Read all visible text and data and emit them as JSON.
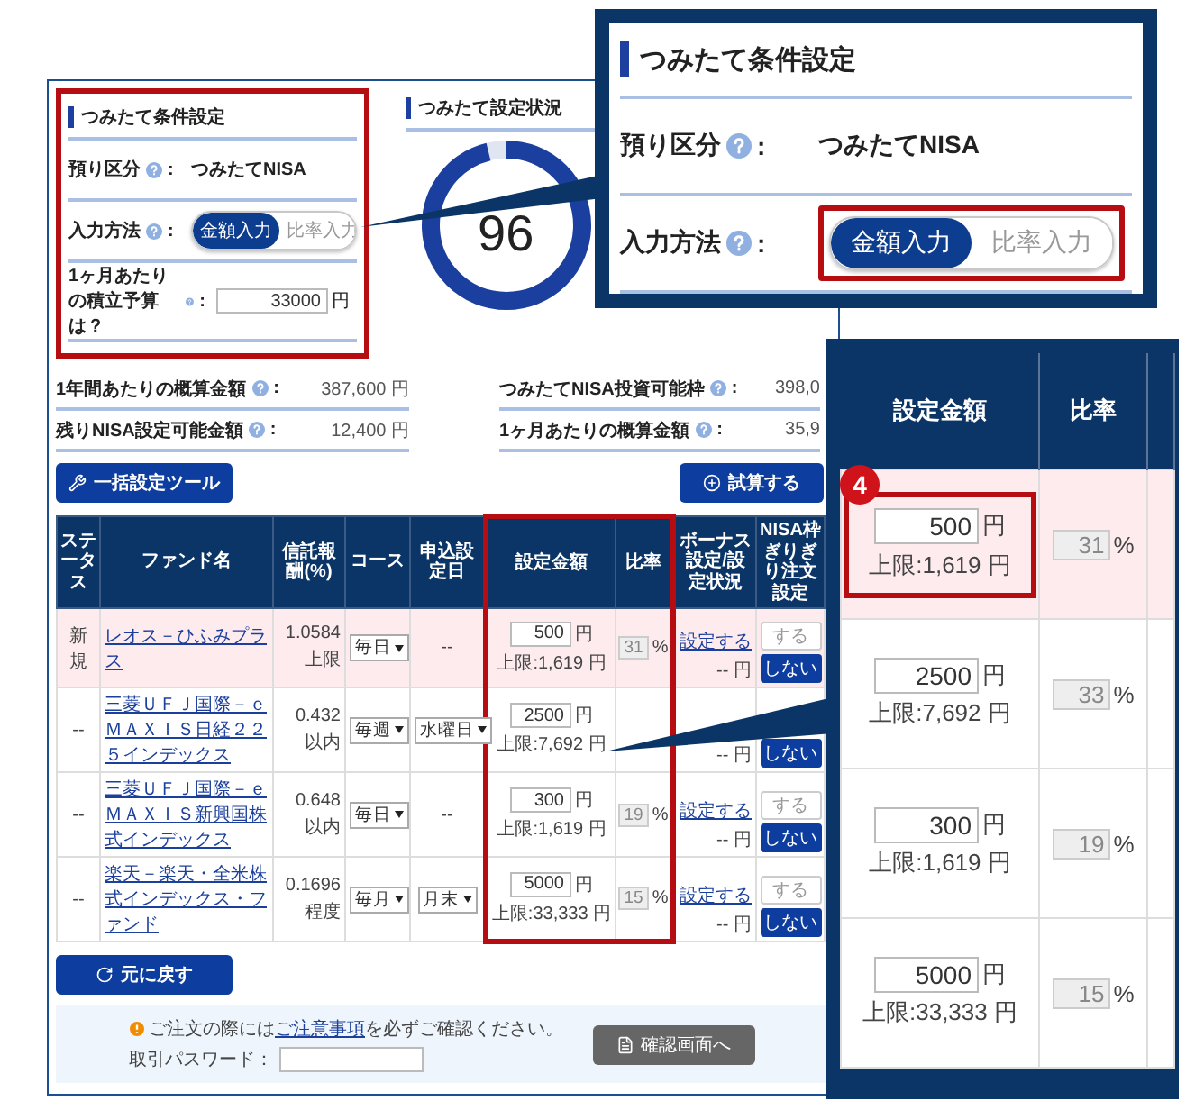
{
  "condition_settings": {
    "title": "つみたて条件設定",
    "rows": [
      {
        "kind": "text",
        "label": "預り区分",
        "colon": ":",
        "value": "つみたてNISA"
      },
      {
        "kind": "toggle",
        "label": "入力方法",
        "colon": ":",
        "options": [
          {
            "label": "金額入力",
            "selected": true
          },
          {
            "label": "比率入力",
            "selected": false
          }
        ]
      },
      {
        "kind": "input",
        "label": "1ヶ月あたりの積立予算は？",
        "colon": ":",
        "value": "33000",
        "unit": "円"
      }
    ]
  },
  "status": {
    "title": "つみたて設定状況",
    "percent": "96",
    "level": 0.96
  },
  "summary": [
    [
      {
        "label": "1年間あたりの概算金額",
        "colon": ":",
        "value": "387,600 円"
      },
      {
        "label": "残りNISA設定可能金額",
        "colon": ":",
        "value": "12,400 円"
      }
    ],
    [
      {
        "label": "つみたてNISA投資可能枠",
        "colon": ":",
        "value": "398,0"
      },
      {
        "label": "1ヶ月あたりの概算金額",
        "colon": ":",
        "value": "35,9"
      }
    ]
  ],
  "tools": {
    "bulk_button": "一括設定ツール",
    "simulate_button": "試算する"
  },
  "table": {
    "columns": [
      "ステータス",
      "ファンド名",
      "信託報酬(%)",
      "コース",
      "申込設定日",
      "設定金額",
      "比率",
      "ボーナス設定/設定状況",
      "NISA枠ぎりぎり注文設定"
    ],
    "rows": [
      {
        "highlighted": true,
        "status": "新規",
        "fund": "レオス－ひふみプラス",
        "fee": "1.0584",
        "fee_note": "上限",
        "course": "毎日",
        "apply_day": {
          "kind": "text",
          "value": "--"
        },
        "amount": "500",
        "unit": "円",
        "limit": "上限:1,619 円",
        "ratio": "31",
        "percent": "%",
        "bonus_link": "設定する",
        "bonus_amount": "-- 円",
        "nisa": [
          {
            "label": "する",
            "selected": false
          },
          {
            "label": "しない",
            "selected": true
          }
        ]
      },
      {
        "highlighted": false,
        "status": "--",
        "fund": "三菱ＵＦＪ国際－ｅＭＡＸＩＳ日経２２５インデックス",
        "fee": "0.432",
        "fee_note": "以内",
        "course": "毎週",
        "apply_day": {
          "kind": "select",
          "value": "水曜日"
        },
        "amount": "2500",
        "unit": "円",
        "limit": "上限:7,692 円",
        "bonus_amount": "-- 円",
        "nisa": [
          {
            "label": "しない",
            "selected": true
          }
        ]
      },
      {
        "highlighted": false,
        "status": "--",
        "fund": "三菱ＵＦＪ国際－ｅＭＡＸＩＳ新興国株式インデックス",
        "fee": "0.648",
        "fee_note": "以内",
        "course": "毎日",
        "apply_day": {
          "kind": "text",
          "value": "--"
        },
        "amount": "300",
        "unit": "円",
        "limit": "上限:1,619 円",
        "ratio": "19",
        "percent": "%",
        "bonus_link": "設定する",
        "bonus_amount": "-- 円",
        "nisa": [
          {
            "label": "する",
            "selected": false
          },
          {
            "label": "しない",
            "selected": true
          }
        ]
      },
      {
        "highlighted": false,
        "status": "--",
        "fund": "楽天－楽天・全米株式インデックス・ファンド",
        "fee": "0.1696",
        "fee_note": "程度",
        "course": "毎月",
        "apply_day": {
          "kind": "select",
          "value": "月末"
        },
        "amount": "5000",
        "unit": "円",
        "limit": "上限:33,333 円",
        "ratio": "15",
        "percent": "%",
        "bonus_link": "設定する",
        "bonus_amount": "-- 円",
        "nisa": [
          {
            "label": "する",
            "selected": false
          },
          {
            "label": "しない",
            "selected": true
          }
        ]
      }
    ]
  },
  "back_button": "元に戻す",
  "footer": {
    "notice_before": "ご注文の際には",
    "notice_link": "ご注意事項",
    "notice_after": "を必ずご確認ください。",
    "password_label": "取引パスワード：",
    "confirm_button": "確認画面へ"
  },
  "zoom_conditions": {
    "title": "つみたて条件設定",
    "rows": [
      {
        "kind": "text",
        "label": "預り区分",
        "colon": ":",
        "value": "つみたてNISA"
      },
      {
        "kind": "toggle",
        "label": "入力方法",
        "colon": ":",
        "options": [
          {
            "label": "金額入力",
            "selected": true
          },
          {
            "label": "比率入力",
            "selected": false
          }
        ]
      }
    ]
  },
  "zoom_amounts": {
    "columns": [
      "設定金額",
      "比率"
    ],
    "step": "4",
    "rows": [
      {
        "highlighted": true,
        "amount": "500",
        "unit": "円",
        "limit": "上限:1,619 円",
        "ratio": "31",
        "percent": "%"
      },
      {
        "highlighted": false,
        "amount": "2500",
        "unit": "円",
        "limit": "上限:7,692 円",
        "ratio": "33",
        "percent": "%"
      },
      {
        "highlighted": false,
        "amount": "300",
        "unit": "円",
        "limit": "上限:1,619 円",
        "ratio": "19",
        "percent": "%"
      },
      {
        "highlighted": false,
        "amount": "5000",
        "unit": "円",
        "limit": "上限:33,333 円",
        "ratio": "15",
        "percent": "%"
      }
    ]
  }
}
